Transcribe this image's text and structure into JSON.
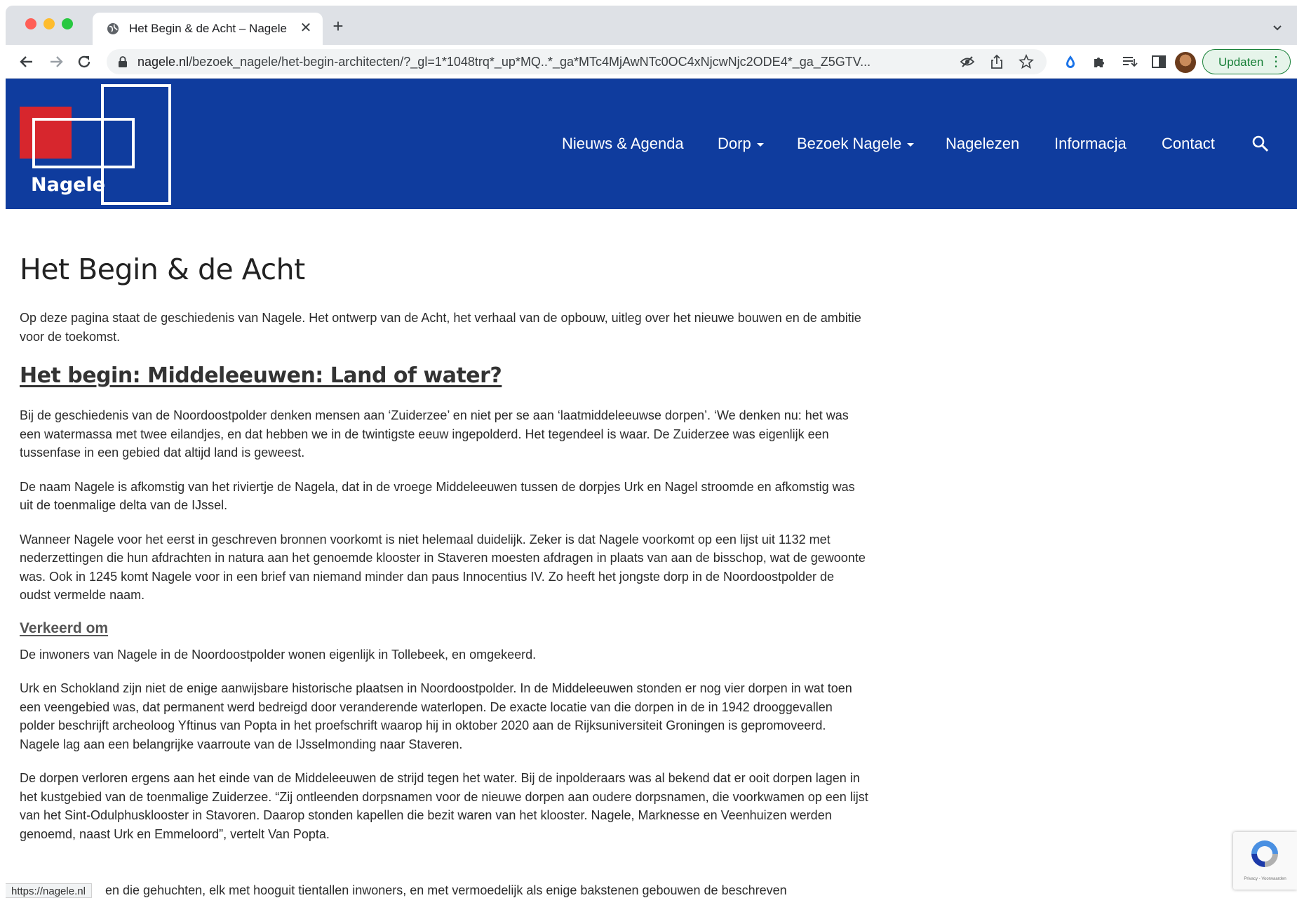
{
  "browser": {
    "tab_title": "Het Begin & de Acht – Nagele",
    "url_host": "nagele.nl",
    "url_path": "/bezoek_nagele/het-begin-architecten/?_gl=1*1048trq*_up*MQ..*_ga*MTc4MjAwNTc0OC4xNjcwNjc2ODE4*_ga_Z5GTV...",
    "update_label": "Updaten",
    "status_url": "https://nagele.nl"
  },
  "site": {
    "logo_text": "Nagele",
    "brand_color": "#0f3c9e",
    "logo_accent": "#d7262d",
    "menu": [
      {
        "label": "Nieuws & Agenda"
      },
      {
        "label": "Dorp"
      },
      {
        "label": "Bezoek Nagele"
      },
      {
        "label": "Nagelezen"
      },
      {
        "label": "Informacja"
      },
      {
        "label": "Contact"
      }
    ]
  },
  "article": {
    "title": "Het Begin & de Acht",
    "intro": "Op deze pagina staat de geschiedenis van Nagele. Het ontwerp van de Acht, het verhaal van de opbouw, uitleg over het nieuwe bouwen en de ambitie voor de toekomst.",
    "heading1": "Het begin: Middeleeuwen: Land of water?",
    "p1": "Bij de geschiedenis van de Noordoostpolder denken mensen aan ‘Zuiderzee’ en niet per se aan ‘laatmiddeleeuwse dorpen’. ‘We denken nu: het was een watermassa met twee eilandjes, en dat hebben we in de twintigste eeuw ingepolderd. Het tegendeel is waar. De Zuiderzee was eigenlijk een tussenfase in een gebied dat altijd land is geweest.",
    "p2": "De naam Nagele is afkomstig van het riviertje de Nagela, dat in de vroege Middeleeuwen tussen de dorpjes Urk en Nagel stroomde en afkomstig was uit de toenmalige delta van de IJssel.",
    "p3": "Wanneer Nagele voor het eerst in geschreven bronnen voorkomt is niet helemaal duidelijk. Zeker is dat Nagele voorkomt op een lijst uit 1132 met nederzettingen die hun afdrachten in natura aan het genoemde klooster in Staveren moesten afdragen in plaats van aan de bisschop, wat de gewoonte was. Ook in 1245 komt Nagele voor in een brief van niemand minder dan paus Innocentius IV. Zo heeft het jongste dorp in de Noordoostpolder de oudst vermelde naam.",
    "heading2": "Verkeerd om",
    "p4": "De inwoners van Nagele in de Noordoostpolder wonen eigenlijk in Tollebeek, en omgekeerd.",
    "p5": "Urk en Schokland zijn niet de enige aanwijsbare historische plaatsen in Noordoostpolder. In de Middeleeuwen stonden er nog vier dorpen in wat toen een veengebied was, dat permanent werd bedreigd door veranderende waterlopen. De exacte locatie van die dorpen in de in 1942 drooggevallen polder beschrijft archeoloog Yftinus van Popta in het proefschrift waarop hij in oktober 2020 aan de Rijksuniversiteit Groningen is gepromoveerd. Nagele lag aan een belangrijke vaarroute van de IJsselmonding naar Staveren.",
    "p6": "De dorpen verloren ergens aan het einde van de Middeleeuwen de strijd tegen het water. Bij de inpolderaars was al bekend dat er ooit dorpen lagen in het kustgebied van de toenmalige Zuiderzee. “Zij ontleenden dorpsnamen voor de nieuwe dorpen aan oudere dorpsnamen, die voorkwamen op een lijst van het Sint-Odulphusklooster in Stavoren. Daarop stonden kapellen die bezit waren van het klooster. Nagele, Marknesse en Veenhuizen werden genoemd, naast Urk en Emmeloord”, vertelt Van Popta.",
    "p7_partial": "en die gehuchten, elk met hooguit tientallen inwoners, en met vermoedelijk als enige bakstenen gebouwen de beschreven"
  },
  "recaptcha": {
    "text": "Privacy - Voorwaarden"
  }
}
